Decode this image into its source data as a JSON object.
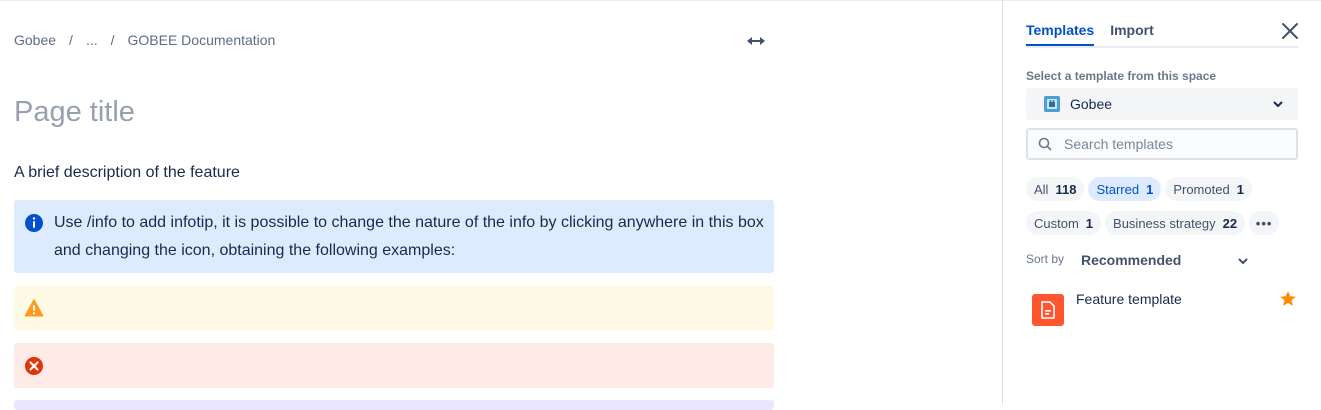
{
  "breadcrumb": {
    "items": [
      "Gobee",
      "...",
      "GOBEE Documentation"
    ],
    "separator": "/"
  },
  "editor": {
    "page_title_placeholder": "Page title",
    "description": "A brief description of the feature",
    "panels": {
      "info_text": "Use /info to add infotip, it is possible to change the nature of the info by clicking anywhere in this box and changing the icon, obtaining the following examples:",
      "info_icon": "info-icon",
      "warning_icon": "warning-icon",
      "error_icon": "error-icon"
    }
  },
  "sidebar": {
    "tabs": [
      {
        "label": "Templates",
        "active": true
      },
      {
        "label": "Import",
        "active": false
      }
    ],
    "select_label": "Select a template from this space",
    "space": "Gobee",
    "search_placeholder": "Search templates",
    "chips": [
      {
        "label": "All",
        "count": "118",
        "selected": false
      },
      {
        "label": "Starred",
        "count": "1",
        "selected": true
      },
      {
        "label": "Promoted",
        "count": "1",
        "selected": false
      },
      {
        "label": "Custom",
        "count": "1",
        "selected": false
      },
      {
        "label": "Business strategy",
        "count": "22",
        "selected": false
      }
    ],
    "more_label": "•••",
    "sort_label": "Sort by",
    "sort_value": "Recommended",
    "templates": [
      {
        "name": "Feature template",
        "starred": true
      }
    ]
  },
  "colors": {
    "accent": "#0052cc",
    "info_bg": "#deebff",
    "warn_bg": "#fffae6",
    "error_bg": "#ffebe6",
    "template_icon": "#ff5630",
    "star": "#ff8b00"
  }
}
